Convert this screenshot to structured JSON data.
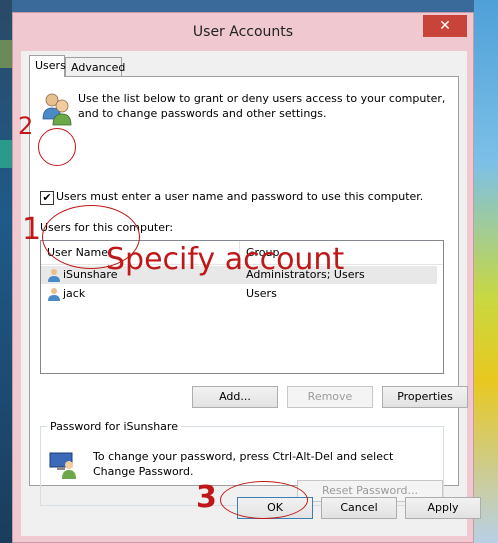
{
  "window": {
    "title": "User Accounts",
    "close_glyph": "✕"
  },
  "tabs": [
    {
      "label": "Users"
    },
    {
      "label": "Advanced"
    }
  ],
  "intro_text": "Use the list below to grant or deny users access to your computer, and to change passwords and other settings.",
  "require_login": {
    "label": "Users must enter a user name and password to use this computer.",
    "checked": true,
    "mark": "✔"
  },
  "users_label": "Users for this computer:",
  "table": {
    "columns": [
      "User Name",
      "Group"
    ],
    "rows": [
      {
        "name": "iSunshare",
        "group": "Administrators; Users"
      },
      {
        "name": "jack",
        "group": "Users"
      }
    ]
  },
  "list_buttons": {
    "add": "Add...",
    "remove": "Remove",
    "properties": "Properties"
  },
  "password_group": {
    "title": "Password for iSunshare",
    "text": "To change your password, press Ctrl-Alt-Del and select Change Password.",
    "reset_label": "Reset Password..."
  },
  "dialog_buttons": {
    "ok": "OK",
    "cancel": "Cancel",
    "apply": "Apply"
  },
  "annotations": {
    "n1": "1",
    "n2": "2",
    "n3": "3",
    "specify": "Specify account"
  },
  "colors": {
    "annotation": "#c01818",
    "frame": "#f0c8d0",
    "close": "#c8443a"
  }
}
